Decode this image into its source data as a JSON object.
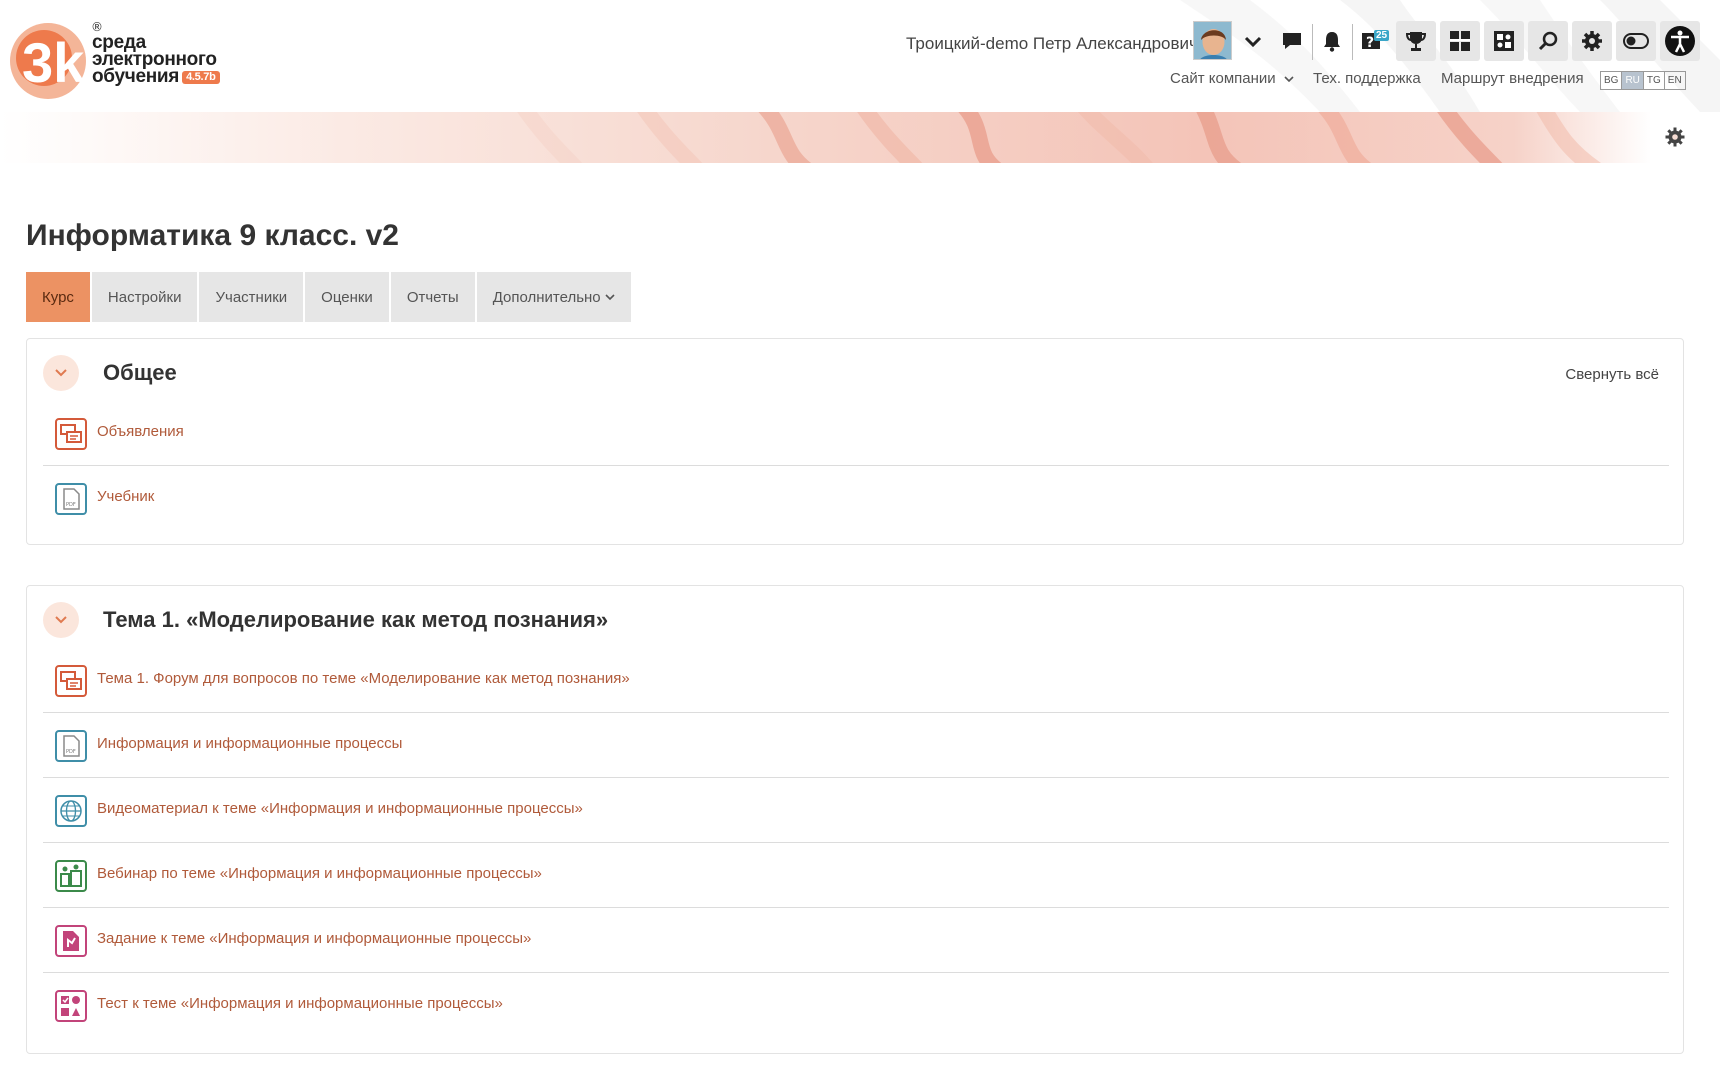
{
  "header": {
    "logo": {
      "line1": "среда",
      "line2": "электронного",
      "line3": "обучения",
      "version": "4.5.7b",
      "mark": "3k",
      "reg": "®"
    },
    "user_name": "Троицкий-demo Петр Александрович",
    "icons": [
      "chevron-down-icon",
      "chat-icon",
      "bell-icon",
      "question-icon",
      "trophy-icon",
      "dashboard-icon",
      "puzzle-icon",
      "search-icon",
      "gear-icon",
      "toggle-icon",
      "accessibility-icon"
    ],
    "question_badge": "25",
    "nav": {
      "company_site": "Сайт компании",
      "support": "Тех. поддержка",
      "route": "Маршрут внедрения"
    },
    "languages": [
      "BG",
      "RU",
      "TG",
      "EN"
    ],
    "active_language": "RU",
    "accent": "#ec9263"
  },
  "course": {
    "title": "Информатика 9 класс. v2",
    "tabs": [
      "Курс",
      "Настройки",
      "Участники",
      "Оценки",
      "Отчеты",
      "Дополнительно"
    ],
    "active_tab": "Курс"
  },
  "sections": [
    {
      "title": "Общее",
      "collapse_all": "Свернуть всё",
      "activities": [
        {
          "type": "forum",
          "name": "Объявления"
        },
        {
          "type": "pdf",
          "name": "Учебник"
        }
      ]
    },
    {
      "title": "Тема 1. «Моделирование как метод познания»",
      "activities": [
        {
          "type": "forum",
          "name": "Тема 1. Форум для вопросов по теме «Моделирование как метод познания»"
        },
        {
          "type": "pdf",
          "name": "Информация и информационные процессы"
        },
        {
          "type": "url",
          "name": "Видеоматериал к теме «Информация и информационные процессы»"
        },
        {
          "type": "webinar",
          "name": "Вебинар по теме «Информация и информационные процессы»"
        },
        {
          "type": "assign",
          "name": "Задание к теме «Информация и информационные процессы»"
        },
        {
          "type": "quiz",
          "name": "Тест к теме «Информация и информационные процессы»"
        }
      ]
    }
  ]
}
